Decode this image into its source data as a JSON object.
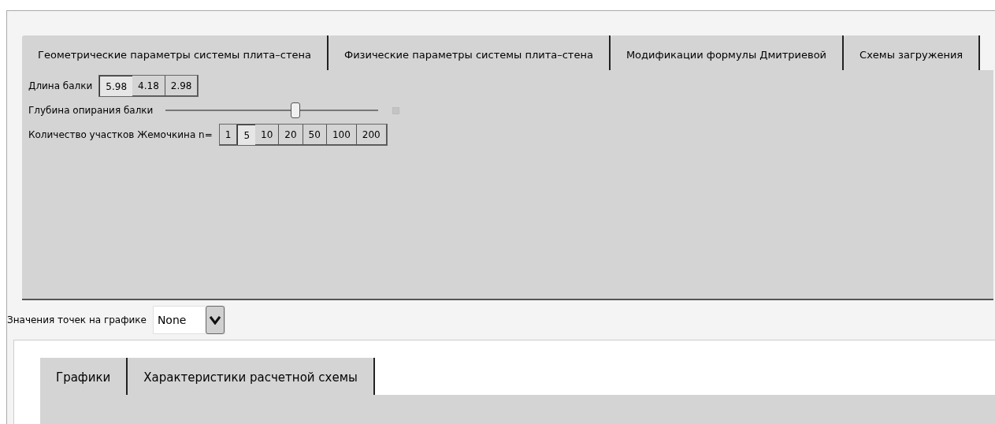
{
  "top_tabs": [
    {
      "label": "Геометрические параметры системы плита–стена"
    },
    {
      "label": "Физические параметры системы плита–стена"
    },
    {
      "label": "Модификации формулы Дмитриевой"
    },
    {
      "label": "Схемы загружения"
    }
  ],
  "beam_length": {
    "label": "Длина балки",
    "options": [
      {
        "label": "5.98",
        "selected": true
      },
      {
        "label": "4.18",
        "selected": false
      },
      {
        "label": "2.98",
        "selected": false
      }
    ]
  },
  "support_depth": {
    "label": "Глубина опирания балки",
    "level": 0.61
  },
  "zhemochkin": {
    "label": "Количество участков Жемочкина n=",
    "options": [
      {
        "label": "1",
        "selected": false
      },
      {
        "label": "5",
        "selected": true
      },
      {
        "label": "10",
        "selected": false
      },
      {
        "label": "20",
        "selected": false
      },
      {
        "label": "50",
        "selected": false
      },
      {
        "label": "100",
        "selected": false
      },
      {
        "label": "200",
        "selected": false
      }
    ]
  },
  "point_values": {
    "label": "Значения точек на графике",
    "value": "None"
  },
  "bottom_tabs": [
    {
      "label": "Графики"
    },
    {
      "label": "Характеристики расчетной схемы"
    }
  ]
}
